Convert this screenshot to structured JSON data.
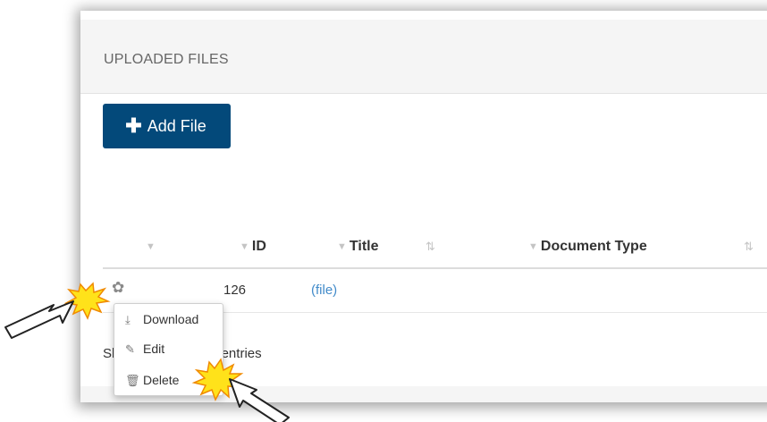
{
  "panel": {
    "title": "UPLOADED FILES",
    "add_button": {
      "icon": "plus-icon",
      "label": "Add File"
    }
  },
  "table": {
    "columns": [
      {
        "label": "",
        "filter_icon": "funnel-icon"
      },
      {
        "label": "ID",
        "filter_icon": "funnel-icon"
      },
      {
        "label": "Title",
        "filter_icon": "funnel-icon",
        "sort_icon": "sort-icon"
      },
      {
        "label": "Document Type",
        "filter_icon": "funnel-icon",
        "sort_icon": "sort-icon"
      }
    ],
    "rows": [
      {
        "actions_icon": "gear-icon",
        "id": "126",
        "title": "(file)",
        "document_type": ""
      }
    ],
    "info_text": "Showing 1 to 1 of 1 entries",
    "info_visible": "f 1 entries"
  },
  "context_menu": {
    "items": [
      {
        "icon": "download-icon",
        "label": "Download"
      },
      {
        "icon": "pencil-icon",
        "label": "Edit"
      },
      {
        "icon": "trash-icon",
        "label": "Delete"
      }
    ]
  },
  "annotations": {
    "arrows": [
      "arrow-to-gear",
      "arrow-to-delete"
    ],
    "colors": {
      "burst_fill": "#ffe21a",
      "burst_stroke": "#f08a00",
      "primary_button": "#03497a",
      "link": "#428bca"
    }
  }
}
